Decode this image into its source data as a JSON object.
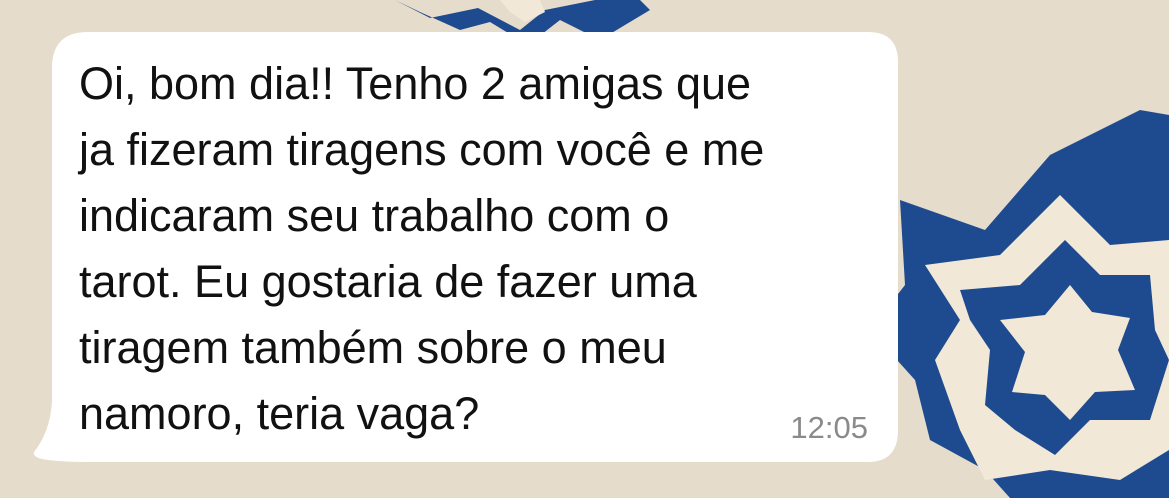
{
  "chat": {
    "message": {
      "text": "Oi, bom dia!! Tenho 2 amigas que\nja fizeram tiragens com você e me\nindicaram seu trabalho com o\ntarot. Eu gostaria de fazer uma\ntiragem também sobre o meu\nnamoro, teria vaga?",
      "time": "12:05",
      "direction": "incoming"
    }
  },
  "wallpaper": {
    "background_color": "#e6dccc",
    "star_color": "#1e4b8f",
    "star_inner_color": "#f2e8d8",
    "icon": "star-icon"
  },
  "bubble": {
    "color": "#ffffff"
  }
}
